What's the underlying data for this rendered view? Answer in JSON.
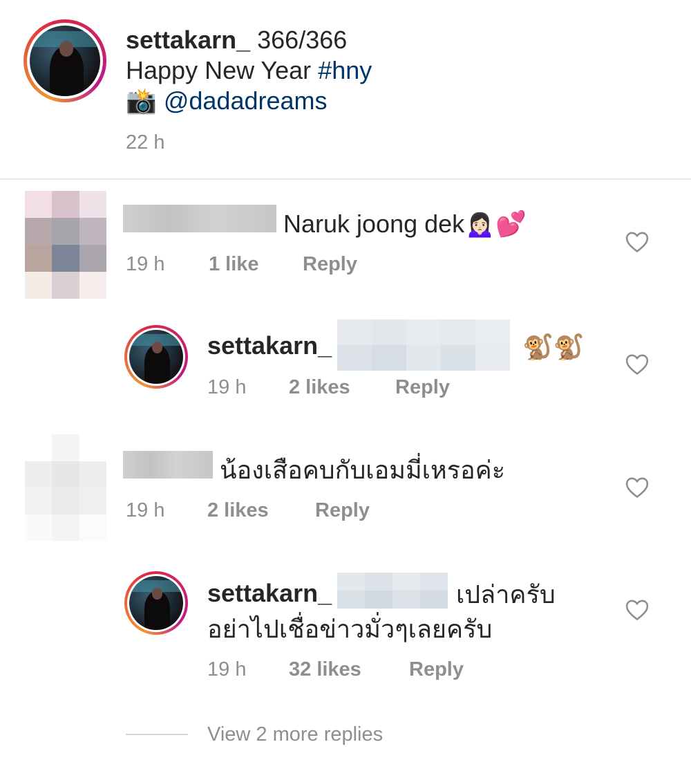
{
  "post": {
    "username": "settakarn_",
    "caption_line1": "366/366",
    "caption_line2_text": "Happy New Year ",
    "caption_hashtag": "#hny",
    "camera_emoji": "📸",
    "caption_mention": "@dadadreams",
    "time": "22 h"
  },
  "comments": [
    {
      "text": "Naruk joong dek🙍🏻‍♀️💕",
      "time": "19 h",
      "likes": "1 like",
      "reply_label": "Reply"
    },
    {
      "username": "settakarn_",
      "text": "🐒🐒",
      "time": "19 h",
      "likes": "2 likes",
      "reply_label": "Reply"
    },
    {
      "text": "น้องเสือคบกับเอมมี่เหรอค่ะ",
      "time": "19 h",
      "likes": "2 likes",
      "reply_label": "Reply"
    },
    {
      "username": "settakarn_",
      "text_line1": "เปล่าครับ",
      "text_line2": "อย่าไปเชื่อข่าวมั่วๆเลยครับ",
      "time": "19 h",
      "likes": "32 likes",
      "reply_label": "Reply"
    }
  ],
  "view_more_replies": "View 2 more replies",
  "colors": {
    "text": "#262626",
    "secondary": "#8e8e8e",
    "link": "#003569",
    "divider": "#e9e9e9"
  }
}
